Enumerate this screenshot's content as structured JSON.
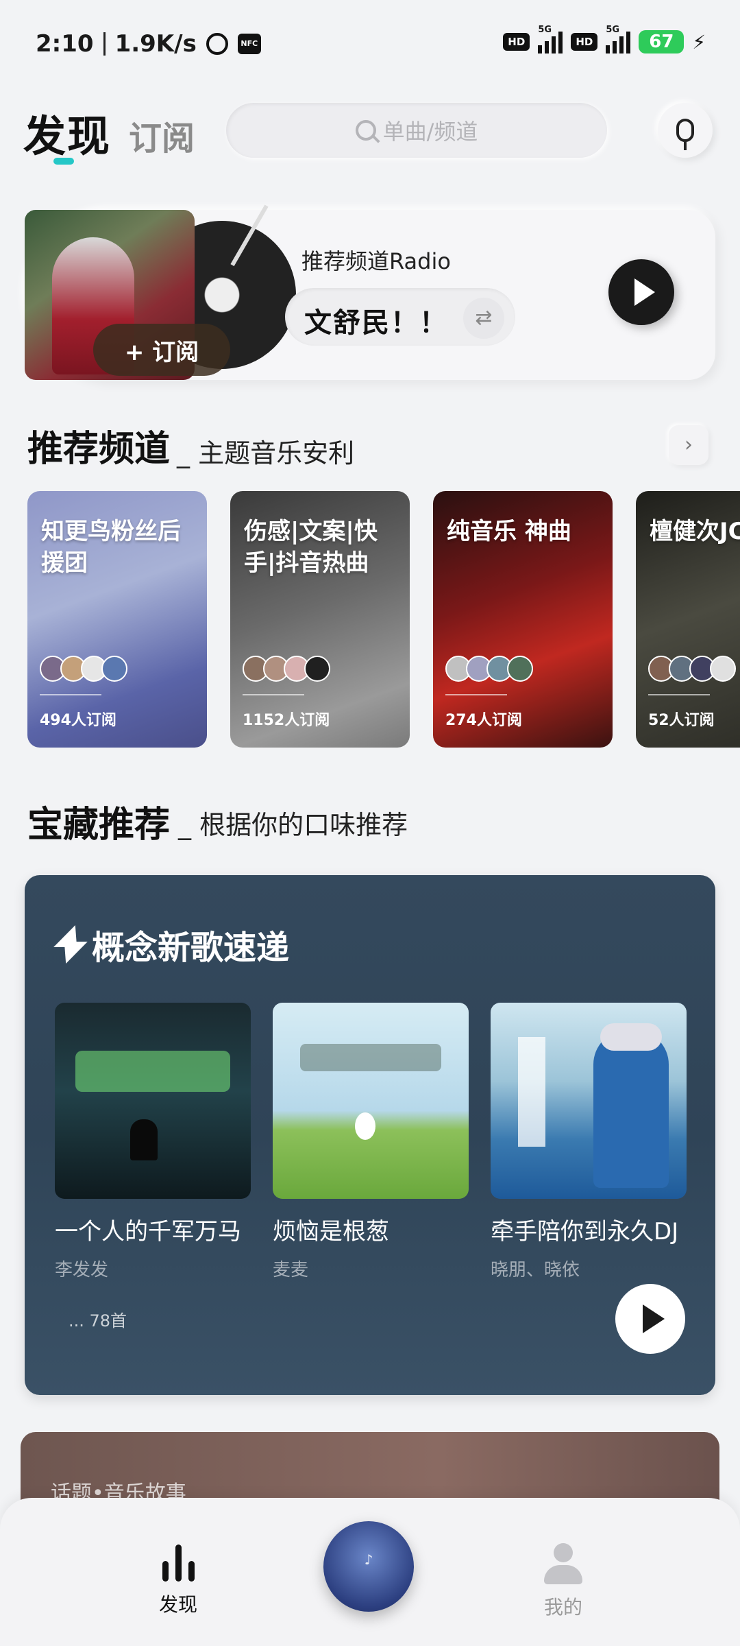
{
  "status_bar": {
    "time": "2:10",
    "speed": "1.9K/s",
    "hd1": "HD",
    "net1": "5G",
    "hd2": "HD",
    "net2": "5G",
    "battery": "67"
  },
  "header": {
    "tab_active": "发现",
    "tab_inactive": "订阅",
    "search_placeholder": "单曲/频道"
  },
  "radio": {
    "subscribe_label": "+ 订阅",
    "label": "推荐频道Radio",
    "channel_name": "文舒民！！"
  },
  "recommend": {
    "title": "推荐频道",
    "subtitle": "_ 主题音乐安利",
    "channels": [
      {
        "title": "知更鸟粉丝后援团",
        "count": "494人订阅"
      },
      {
        "title": "伤感|文案|快手|抖音热曲",
        "count": "1152人订阅"
      },
      {
        "title": "纯音乐 神曲",
        "count": "274人订阅"
      },
      {
        "title": "檀健次JC",
        "count": "52人订阅"
      }
    ]
  },
  "treasure": {
    "title": "宝藏推荐",
    "subtitle": "_ 根据你的口味推荐",
    "card_title": "概念新歌速递",
    "songs": [
      {
        "title": "一个人的千军万马",
        "artist": "李发发"
      },
      {
        "title": "烦恼是根葱",
        "artist": "麦麦"
      },
      {
        "title": "牵手陪你到永久DJ",
        "artist": "晓朋、晓依"
      }
    ],
    "count": "... 78首"
  },
  "story": {
    "label": "话题•音乐故事"
  },
  "bottom_nav": {
    "discover": "发现",
    "mine": "我的"
  }
}
